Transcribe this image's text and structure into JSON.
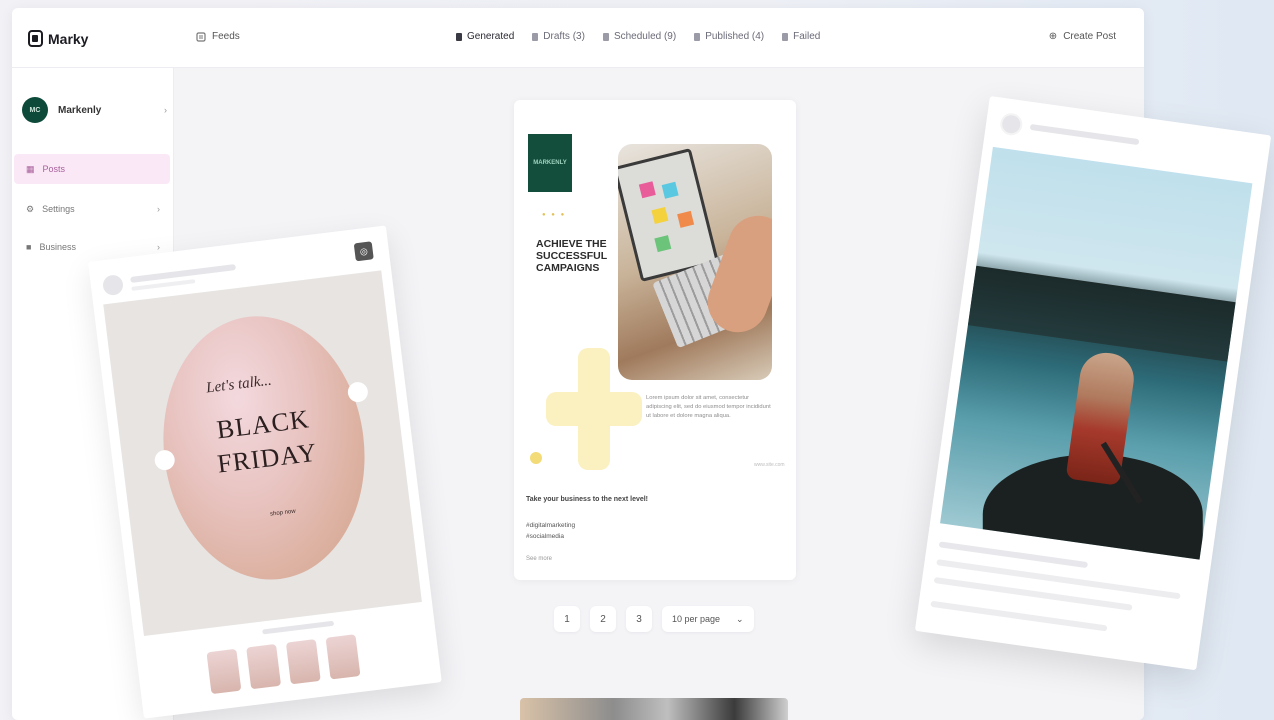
{
  "app": {
    "logo": "Marky"
  },
  "topbar": {
    "feed_label": "Feeds",
    "tabs": [
      {
        "label": "Generated",
        "active": true
      },
      {
        "label": "Drafts (3)",
        "active": false
      },
      {
        "label": "Scheduled (9)",
        "active": false
      },
      {
        "label": "Published (4)",
        "active": false
      },
      {
        "label": "Failed",
        "active": false
      }
    ],
    "create_label": "Create Post"
  },
  "sidebar": {
    "workspace": {
      "initials": "MC",
      "name": "Markenly"
    },
    "items": [
      {
        "label": "Posts",
        "active": true
      },
      {
        "label": "Settings",
        "active": false
      },
      {
        "label": "Business",
        "active": false
      }
    ]
  },
  "center_post": {
    "brand_tag": "MARKENLY",
    "headline": "Achieve the successful campaigns",
    "body": "Lorem ipsum dolor sit amet, consectetur adipiscing elit, sed do eiusmod tempor incididunt ut labore et dolore magna aliqua.",
    "sub": "www.site.com",
    "caption": "Take your business to the next level!",
    "lines": [
      "#digitalmarketing",
      "#socialmedia"
    ],
    "more": "See more"
  },
  "pager": {
    "pages": [
      "1",
      "2",
      "3"
    ],
    "select_label": "10 per page"
  },
  "left_post": {
    "script": "Let's talk...",
    "title": "BLACK FRIDAY",
    "small": "shop now"
  },
  "colors": {
    "accent": "#a7609a",
    "brand_dark": "#134d3b",
    "highlight": "#fbf0c0"
  }
}
